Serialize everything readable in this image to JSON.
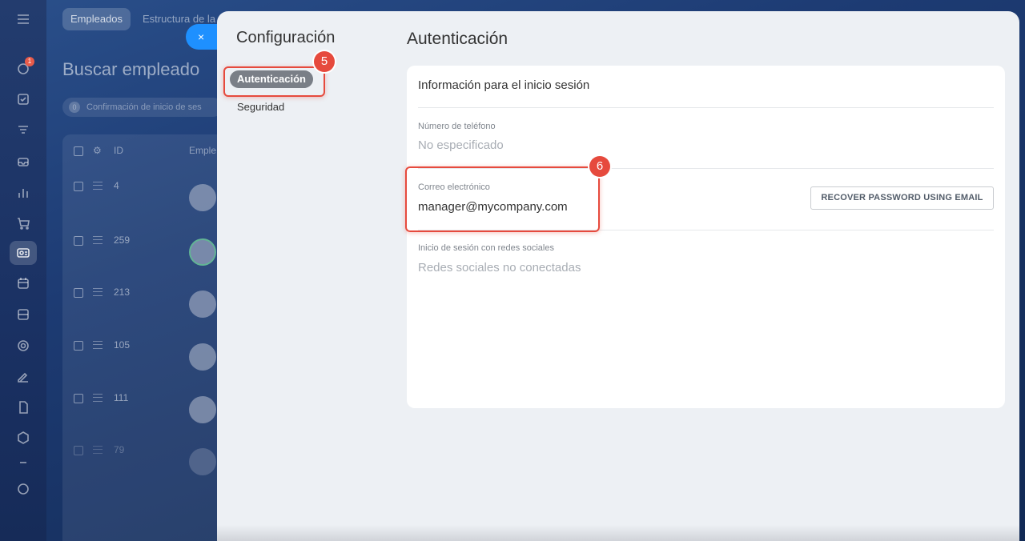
{
  "background": {
    "tabs": [
      "Empleados",
      "Estructura de la"
    ],
    "title": "Buscar empleado",
    "filter_chip": {
      "count": "0",
      "label": "Confirmación de inicio de ses"
    },
    "table": {
      "headers": [
        "ID",
        "Emple"
      ],
      "rows": [
        {
          "id": "4"
        },
        {
          "id": "259"
        },
        {
          "id": "213"
        },
        {
          "id": "105"
        },
        {
          "id": "111"
        },
        {
          "id": "79"
        }
      ]
    },
    "nav_badge": "1"
  },
  "close_icon": "×",
  "sidebar": {
    "title": "Configuración",
    "items": [
      {
        "label": "Autenticación",
        "selected": true
      },
      {
        "label": "Seguridad",
        "selected": false
      }
    ]
  },
  "annotations": {
    "badge_5": "5",
    "badge_6": "6",
    "color": "#e64a3d"
  },
  "main": {
    "title": "Autenticación",
    "card": {
      "title": "Información para el inicio sesión",
      "phone": {
        "label": "Número de teléfono",
        "value": "No especificado"
      },
      "email": {
        "label": "Correo electrónico",
        "value": "manager@mycompany.com"
      },
      "recover_button": "RECOVER PASSWORD USING EMAIL",
      "social": {
        "label": "Inicio de sesión con redes sociales",
        "value": "Redes sociales no conectadas"
      }
    }
  },
  "colors": {
    "accent_blue": "#1e90ff",
    "panel_bg": "#edf0f4",
    "selected_pill": "#7a7f87"
  }
}
